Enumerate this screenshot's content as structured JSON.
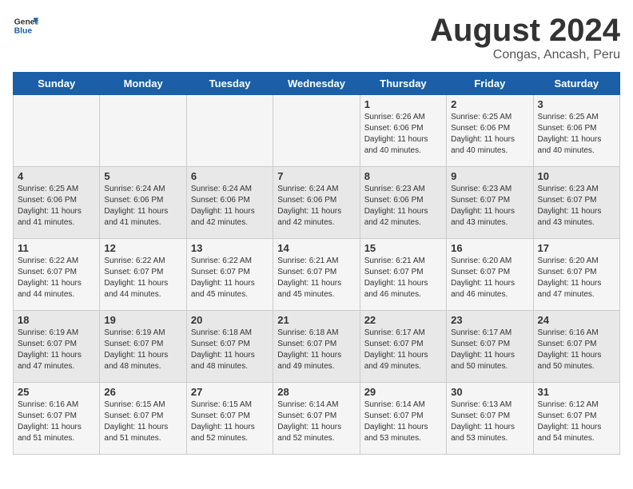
{
  "header": {
    "logo_general": "General",
    "logo_blue": "Blue",
    "title": "August 2024",
    "subtitle": "Congas, Ancash, Peru"
  },
  "days_of_week": [
    "Sunday",
    "Monday",
    "Tuesday",
    "Wednesday",
    "Thursday",
    "Friday",
    "Saturday"
  ],
  "weeks": [
    {
      "cells": [
        {
          "day": "",
          "info": ""
        },
        {
          "day": "",
          "info": ""
        },
        {
          "day": "",
          "info": ""
        },
        {
          "day": "",
          "info": ""
        },
        {
          "day": "1",
          "sunrise": "Sunrise: 6:26 AM",
          "sunset": "Sunset: 6:06 PM",
          "daylight": "Daylight: 11 hours and 40 minutes."
        },
        {
          "day": "2",
          "sunrise": "Sunrise: 6:25 AM",
          "sunset": "Sunset: 6:06 PM",
          "daylight": "Daylight: 11 hours and 40 minutes."
        },
        {
          "day": "3",
          "sunrise": "Sunrise: 6:25 AM",
          "sunset": "Sunset: 6:06 PM",
          "daylight": "Daylight: 11 hours and 40 minutes."
        }
      ]
    },
    {
      "cells": [
        {
          "day": "4",
          "sunrise": "Sunrise: 6:25 AM",
          "sunset": "Sunset: 6:06 PM",
          "daylight": "Daylight: 11 hours and 41 minutes."
        },
        {
          "day": "5",
          "sunrise": "Sunrise: 6:24 AM",
          "sunset": "Sunset: 6:06 PM",
          "daylight": "Daylight: 11 hours and 41 minutes."
        },
        {
          "day": "6",
          "sunrise": "Sunrise: 6:24 AM",
          "sunset": "Sunset: 6:06 PM",
          "daylight": "Daylight: 11 hours and 42 minutes."
        },
        {
          "day": "7",
          "sunrise": "Sunrise: 6:24 AM",
          "sunset": "Sunset: 6:06 PM",
          "daylight": "Daylight: 11 hours and 42 minutes."
        },
        {
          "day": "8",
          "sunrise": "Sunrise: 6:23 AM",
          "sunset": "Sunset: 6:06 PM",
          "daylight": "Daylight: 11 hours and 42 minutes."
        },
        {
          "day": "9",
          "sunrise": "Sunrise: 6:23 AM",
          "sunset": "Sunset: 6:07 PM",
          "daylight": "Daylight: 11 hours and 43 minutes."
        },
        {
          "day": "10",
          "sunrise": "Sunrise: 6:23 AM",
          "sunset": "Sunset: 6:07 PM",
          "daylight": "Daylight: 11 hours and 43 minutes."
        }
      ]
    },
    {
      "cells": [
        {
          "day": "11",
          "sunrise": "Sunrise: 6:22 AM",
          "sunset": "Sunset: 6:07 PM",
          "daylight": "Daylight: 11 hours and 44 minutes."
        },
        {
          "day": "12",
          "sunrise": "Sunrise: 6:22 AM",
          "sunset": "Sunset: 6:07 PM",
          "daylight": "Daylight: 11 hours and 44 minutes."
        },
        {
          "day": "13",
          "sunrise": "Sunrise: 6:22 AM",
          "sunset": "Sunset: 6:07 PM",
          "daylight": "Daylight: 11 hours and 45 minutes."
        },
        {
          "day": "14",
          "sunrise": "Sunrise: 6:21 AM",
          "sunset": "Sunset: 6:07 PM",
          "daylight": "Daylight: 11 hours and 45 minutes."
        },
        {
          "day": "15",
          "sunrise": "Sunrise: 6:21 AM",
          "sunset": "Sunset: 6:07 PM",
          "daylight": "Daylight: 11 hours and 46 minutes."
        },
        {
          "day": "16",
          "sunrise": "Sunrise: 6:20 AM",
          "sunset": "Sunset: 6:07 PM",
          "daylight": "Daylight: 11 hours and 46 minutes."
        },
        {
          "day": "17",
          "sunrise": "Sunrise: 6:20 AM",
          "sunset": "Sunset: 6:07 PM",
          "daylight": "Daylight: 11 hours and 47 minutes."
        }
      ]
    },
    {
      "cells": [
        {
          "day": "18",
          "sunrise": "Sunrise: 6:19 AM",
          "sunset": "Sunset: 6:07 PM",
          "daylight": "Daylight: 11 hours and 47 minutes."
        },
        {
          "day": "19",
          "sunrise": "Sunrise: 6:19 AM",
          "sunset": "Sunset: 6:07 PM",
          "daylight": "Daylight: 11 hours and 48 minutes."
        },
        {
          "day": "20",
          "sunrise": "Sunrise: 6:18 AM",
          "sunset": "Sunset: 6:07 PM",
          "daylight": "Daylight: 11 hours and 48 minutes."
        },
        {
          "day": "21",
          "sunrise": "Sunrise: 6:18 AM",
          "sunset": "Sunset: 6:07 PM",
          "daylight": "Daylight: 11 hours and 49 minutes."
        },
        {
          "day": "22",
          "sunrise": "Sunrise: 6:17 AM",
          "sunset": "Sunset: 6:07 PM",
          "daylight": "Daylight: 11 hours and 49 minutes."
        },
        {
          "day": "23",
          "sunrise": "Sunrise: 6:17 AM",
          "sunset": "Sunset: 6:07 PM",
          "daylight": "Daylight: 11 hours and 50 minutes."
        },
        {
          "day": "24",
          "sunrise": "Sunrise: 6:16 AM",
          "sunset": "Sunset: 6:07 PM",
          "daylight": "Daylight: 11 hours and 50 minutes."
        }
      ]
    },
    {
      "cells": [
        {
          "day": "25",
          "sunrise": "Sunrise: 6:16 AM",
          "sunset": "Sunset: 6:07 PM",
          "daylight": "Daylight: 11 hours and 51 minutes."
        },
        {
          "day": "26",
          "sunrise": "Sunrise: 6:15 AM",
          "sunset": "Sunset: 6:07 PM",
          "daylight": "Daylight: 11 hours and 51 minutes."
        },
        {
          "day": "27",
          "sunrise": "Sunrise: 6:15 AM",
          "sunset": "Sunset: 6:07 PM",
          "daylight": "Daylight: 11 hours and 52 minutes."
        },
        {
          "day": "28",
          "sunrise": "Sunrise: 6:14 AM",
          "sunset": "Sunset: 6:07 PM",
          "daylight": "Daylight: 11 hours and 52 minutes."
        },
        {
          "day": "29",
          "sunrise": "Sunrise: 6:14 AM",
          "sunset": "Sunset: 6:07 PM",
          "daylight": "Daylight: 11 hours and 53 minutes."
        },
        {
          "day": "30",
          "sunrise": "Sunrise: 6:13 AM",
          "sunset": "Sunset: 6:07 PM",
          "daylight": "Daylight: 11 hours and 53 minutes."
        },
        {
          "day": "31",
          "sunrise": "Sunrise: 6:12 AM",
          "sunset": "Sunset: 6:07 PM",
          "daylight": "Daylight: 11 hours and 54 minutes."
        }
      ]
    }
  ]
}
